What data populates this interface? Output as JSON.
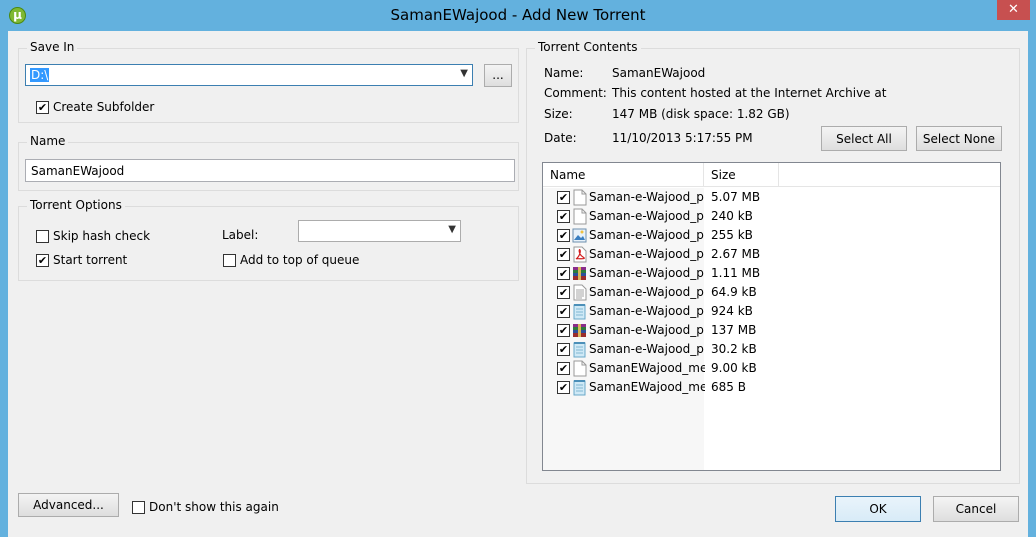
{
  "window": {
    "title": "SamanEWajood - Add New Torrent",
    "close_label": "✕",
    "app_icon": "utorrent-icon"
  },
  "save_in": {
    "group_title": "Save In",
    "path": "D:\\",
    "browse_label": "...",
    "create_subfolder_label": "Create Subfolder",
    "create_subfolder_checked": true
  },
  "name_group": {
    "group_title": "Name",
    "value": "SamanEWajood"
  },
  "torrent_options": {
    "group_title": "Torrent Options",
    "skip_hash_label": "Skip hash check",
    "skip_hash_checked": false,
    "start_torrent_label": "Start torrent",
    "start_torrent_checked": true,
    "label_label": "Label:",
    "label_value": "",
    "add_top_label": "Add to top of queue",
    "add_top_checked": false
  },
  "contents": {
    "group_title": "Torrent Contents",
    "name_label": "Name:",
    "name_value": "SamanEWajood",
    "comment_label": "Comment:",
    "comment_value": "This content hosted at the Internet Archive at",
    "size_label": "Size:",
    "size_value": "147 MB (disk space: 1.82 GB)",
    "date_label": "Date:",
    "date_value": "11/10/2013 5:17:55 PM",
    "select_all_label": "Select All",
    "select_none_label": "Select None",
    "columns": [
      "Name",
      "Size"
    ],
    "files": [
      {
        "name": "Saman-e-Wajood_p...",
        "size": "5.07 MB",
        "icon": "blank-file-icon",
        "checked": true
      },
      {
        "name": "Saman-e-Wajood_p...",
        "size": "240 kB",
        "icon": "blank-file-icon",
        "checked": true
      },
      {
        "name": "Saman-e-Wajood_p...",
        "size": "255 kB",
        "icon": "image-file-icon",
        "checked": true
      },
      {
        "name": "Saman-e-Wajood_p...",
        "size": "2.67 MB",
        "icon": "pdf-file-icon",
        "checked": true
      },
      {
        "name": "Saman-e-Wajood_p...",
        "size": "1.11 MB",
        "icon": "archive-file-icon",
        "checked": true
      },
      {
        "name": "Saman-e-Wajood_p...",
        "size": "64.9 kB",
        "icon": "text-file-icon",
        "checked": true
      },
      {
        "name": "Saman-e-Wajood_p...",
        "size": "924 kB",
        "icon": "notepad-file-icon",
        "checked": true
      },
      {
        "name": "Saman-e-Wajood_p...",
        "size": "137 MB",
        "icon": "archive-file-icon",
        "checked": true
      },
      {
        "name": "Saman-e-Wajood_p...",
        "size": "30.2 kB",
        "icon": "notepad-file-icon",
        "checked": true
      },
      {
        "name": "SamanEWajood_me...",
        "size": "9.00 kB",
        "icon": "blank-file-icon",
        "checked": true
      },
      {
        "name": "SamanEWajood_me...",
        "size": "685 B",
        "icon": "notepad-file-icon",
        "checked": true
      }
    ]
  },
  "footer": {
    "advanced_label": "Advanced...",
    "dont_show_label": "Don't show this again",
    "dont_show_checked": false,
    "ok_label": "OK",
    "cancel_label": "Cancel"
  }
}
